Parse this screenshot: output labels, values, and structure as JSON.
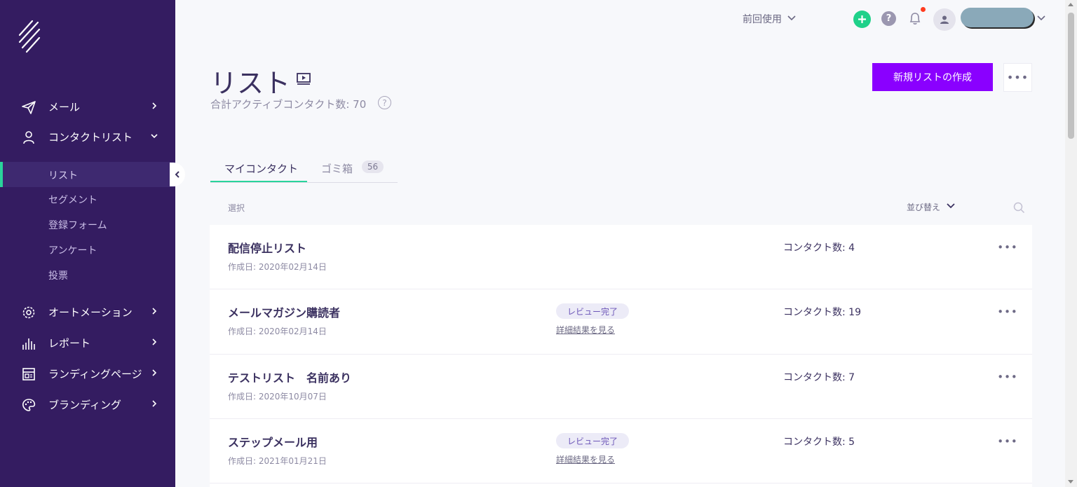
{
  "sidebar": {
    "nav": [
      {
        "label": "メール",
        "icon": "paper-plane-icon"
      },
      {
        "label": "コンタクトリスト",
        "icon": "person-icon"
      },
      {
        "label": "オートメーション",
        "icon": "gear-icon"
      },
      {
        "label": "レポート",
        "icon": "bar-chart-icon"
      },
      {
        "label": "ランディングページ",
        "icon": "landing-page-icon"
      },
      {
        "label": "ブランディング",
        "icon": "palette-icon"
      }
    ],
    "sub_items": [
      "リスト",
      "セグメント",
      "登録フォーム",
      "アンケート",
      "投票"
    ],
    "active_sub": "リスト",
    "accent_color": "#2ad49b",
    "background": "#341c61"
  },
  "topbar": {
    "last_used": "前回使用"
  },
  "header": {
    "title": "リスト",
    "subtitle": "合計アクティブコンタクト数: 70",
    "help": "?",
    "create_button": "新規リストの作成",
    "more": "•••"
  },
  "tabs": [
    {
      "label": "マイコンタクト",
      "active": true
    },
    {
      "label": "ゴミ箱",
      "badge": "56",
      "active": false
    }
  ],
  "toolbar": {
    "select_label": "選択",
    "sort_label": "並び替え"
  },
  "lists": [
    {
      "name": "配信停止リスト",
      "created": "作成日: 2020年02月14日",
      "review": "",
      "details": "",
      "count": "コンタクト数: 4"
    },
    {
      "name": "メールマガジン購読者",
      "created": "作成日: 2020年02月14日",
      "review": "レビュー完了",
      "details": "詳細結果を見る",
      "count": "コンタクト数: 19"
    },
    {
      "name": "テストリスト　名前あり",
      "created": "作成日: 2020年10月07日",
      "review": "",
      "details": "",
      "count": "コンタクト数: 7"
    },
    {
      "name": "ステップメール用",
      "created": "作成日: 2021年01月21日",
      "review": "レビュー完了",
      "details": "詳細結果を見る",
      "count": "コンタクト数: 5"
    }
  ],
  "row_more": "•••",
  "colors": {
    "primary_button": "#8a00ff",
    "add_button": "#1fd18a",
    "notification_dot": "#ff3b1f"
  }
}
